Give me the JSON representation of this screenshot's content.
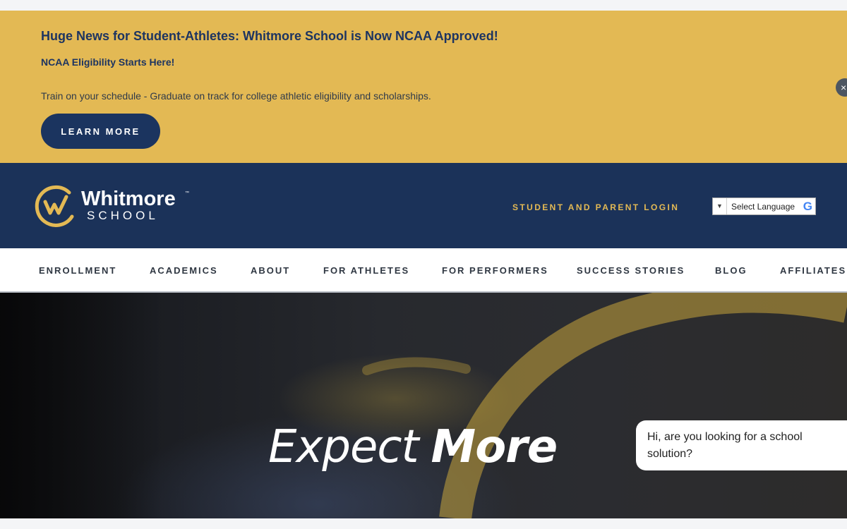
{
  "banner": {
    "headline": "Huge News for Student-Athletes: Whitmore School is Now NCAA Approved!",
    "subheadline": "NCAA Eligibility Starts Here!",
    "body": "Train on your schedule - Graduate on track for college athletic eligibility and scholarships.",
    "cta_label": "LEARN MORE",
    "close_glyph": "×",
    "background_color": "#e3b954",
    "close_icon": "close-icon"
  },
  "header": {
    "logo_name": "Whitmore",
    "logo_trademark": "™",
    "logo_school": "SCHOOL",
    "login_label": "STUDENT AND PARENT LOGIN",
    "language_label": "Select Language",
    "language_arrow": "▼",
    "language_icon": "G",
    "brand_navy": "#1b3259",
    "brand_gold": "#e3b954"
  },
  "nav": {
    "items": [
      {
        "label": "ENROLLMENT"
      },
      {
        "label": "ACADEMICS"
      },
      {
        "label": "ABOUT"
      },
      {
        "label": "FOR ATHLETES"
      },
      {
        "label": "FOR PERFORMERS"
      },
      {
        "label": "SUCCESS STORIES"
      },
      {
        "label": "BLOG"
      },
      {
        "label": "AFFILIATES"
      }
    ]
  },
  "hero": {
    "title_light": "Expect",
    "title_bold": "More"
  },
  "chat": {
    "message": "Hi, are you looking for a school solution?"
  }
}
